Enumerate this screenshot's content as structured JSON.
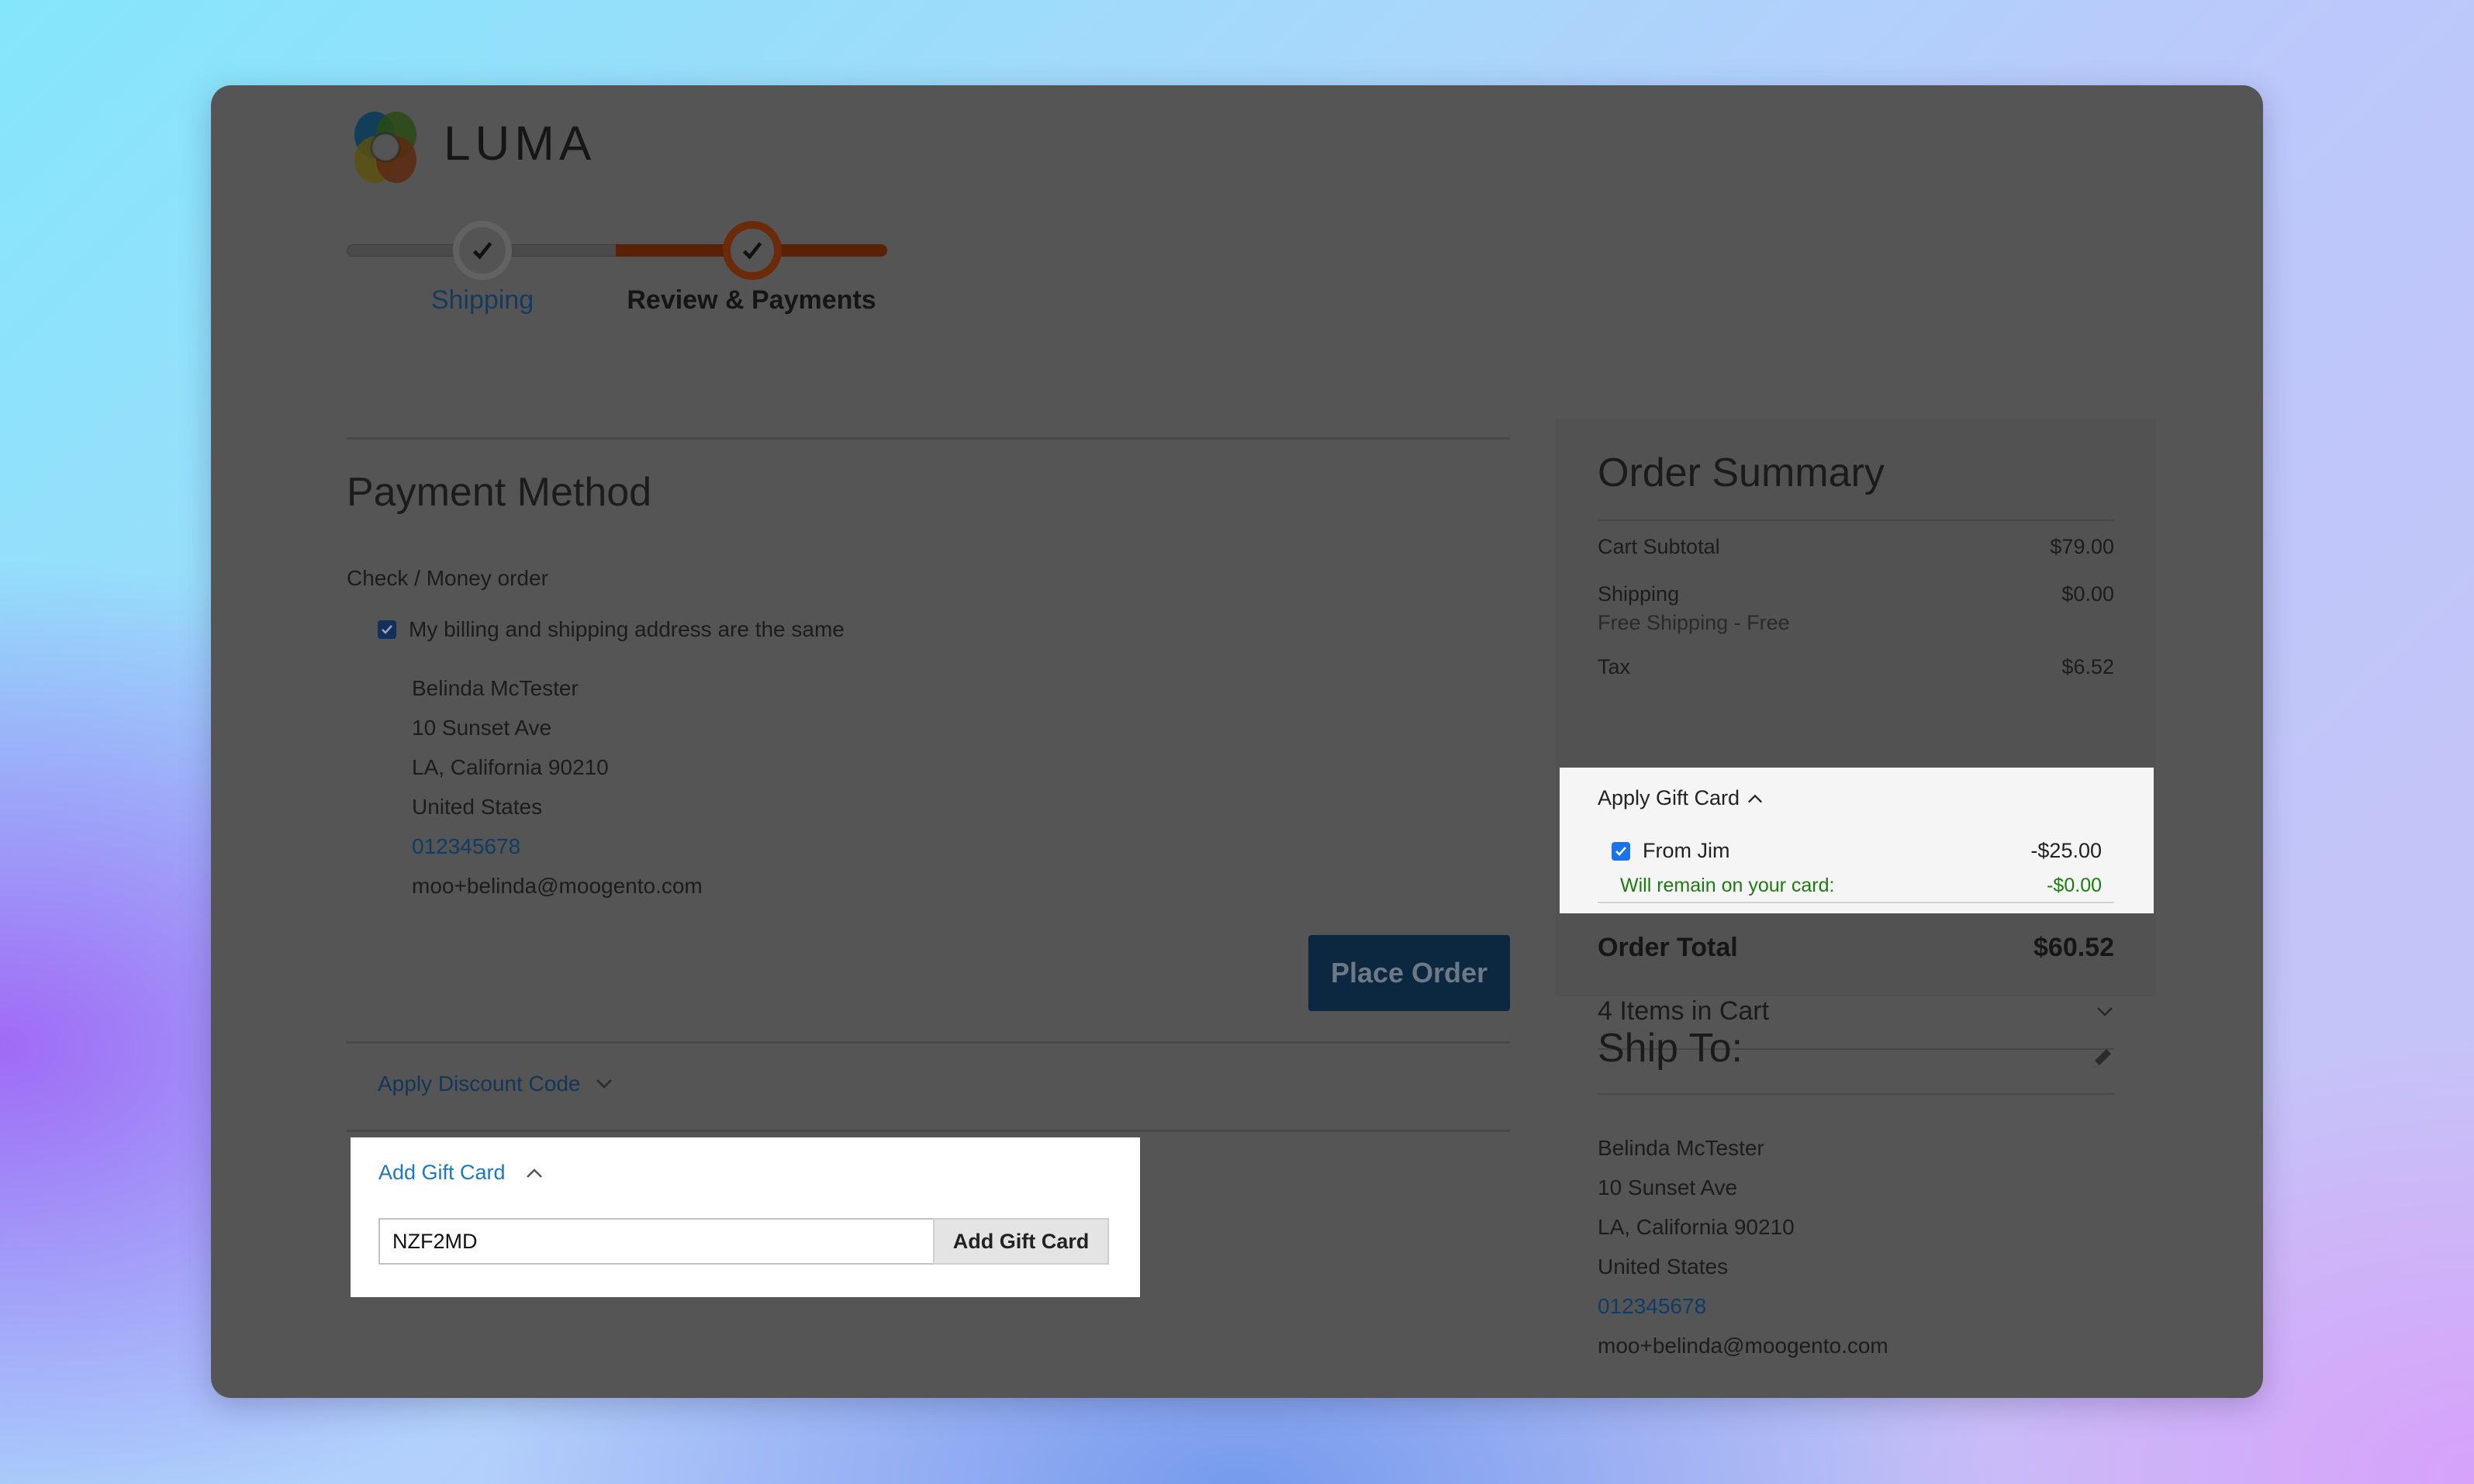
{
  "brand": {
    "name": "LUMA"
  },
  "progress": {
    "steps": [
      {
        "label": "Shipping",
        "state": "completed"
      },
      {
        "label": "Review & Payments",
        "state": "active"
      }
    ]
  },
  "payment": {
    "title": "Payment Method",
    "method": "Check / Money order",
    "same_address_label": "My billing and shipping address are the same",
    "same_address_checked": true,
    "billing_address": {
      "name": "Belinda McTester",
      "street": "10 Sunset Ave",
      "city_line": "LA, California 90210",
      "country": "United States",
      "phone": "012345678",
      "email": "moo+belinda@moogento.com"
    },
    "place_order_label": "Place Order"
  },
  "discount": {
    "label": "Apply Discount Code"
  },
  "gift_card_form": {
    "toggle_label": "Add Gift Card",
    "input_value": "NZF2MD",
    "button_label": "Add Gift Card"
  },
  "summary": {
    "title": "Order Summary",
    "cart_subtotal_label": "Cart Subtotal",
    "cart_subtotal": "$79.00",
    "shipping_label": "Shipping",
    "shipping": "$0.00",
    "shipping_method": "Free Shipping - Free",
    "tax_label": "Tax",
    "tax": "$6.52",
    "gift_card": {
      "title": "Apply Gift Card",
      "card_label": "From Jim",
      "card_checked": true,
      "card_amount": "-$25.00",
      "remain_label": "Will remain on your card:",
      "remain_amount": "-$0.00"
    },
    "order_total_label": "Order Total",
    "order_total": "$60.52",
    "items_in_cart": "4 Items in Cart"
  },
  "ship_to": {
    "title": "Ship To:",
    "name": "Belinda McTester",
    "street": "10 Sunset Ave",
    "city_line": "LA, California 90210",
    "country": "United States",
    "phone": "012345678",
    "email": "moo+belinda@moogento.com"
  },
  "colors": {
    "accent_orange": "#6b2a0a",
    "link_blue": "#1979c3",
    "primary_button": "#0c2740",
    "success_green": "#1f7a13"
  }
}
